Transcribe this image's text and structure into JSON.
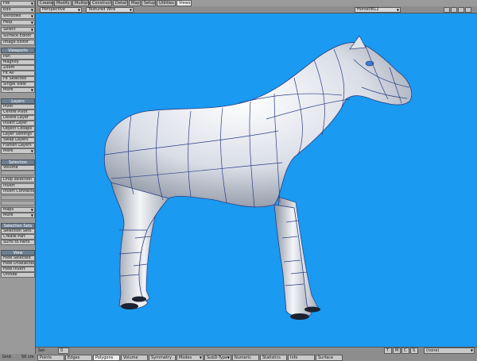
{
  "sidebar": {
    "top_menus": [
      "File",
      "Edit",
      "Windows",
      "Help"
    ],
    "select_label": "Select",
    "editor_buttons": [
      "Surface Editor",
      "Image Editor"
    ],
    "viewports_header": "Viewports",
    "viewports_items": [
      "Pan",
      "Magnify",
      "Zoom",
      "Fit All",
      "Fit Selected",
      "Single View",
      "More"
    ],
    "layers_header": "Layers",
    "layers_items": [
      "Pivot",
      "Centre Pivot",
      "Delete Layer",
      "Invert Layer",
      "Object Collaps",
      "Layer Settings",
      "Swap Layers",
      "Flatten Layers",
      "More"
    ],
    "selection_header": "Selection",
    "selection_items": [
      "Volume",
      "Drop selection",
      "Invert",
      "Invert Connected"
    ],
    "maps_label": "Maps",
    "more_label": "More",
    "selsets_header": "Selection Sets",
    "selsets_items": [
      "Selection Sets",
      "Create Part",
      "Surfs to Parts"
    ],
    "view_header": "View",
    "view_items": [
      "Hide Selected",
      "Hide Unselected",
      "Hide Invert",
      "Unhide"
    ]
  },
  "tabs": [
    "Create",
    "Modify",
    "Multiply",
    "Construct",
    "Detail",
    "Map",
    "Setup",
    "Utilities",
    "Views"
  ],
  "viewport_header": {
    "projection": "Perspective",
    "render_mode": "Textured Wire",
    "object_name": "Horse0B12"
  },
  "bottom_bar": {
    "sel_label": "Sel:",
    "sel_value": "0",
    "mode_buttons": [
      "T",
      "M",
      "C",
      "S"
    ],
    "vmap_value": "(none)"
  },
  "status_bar": {
    "grid_label": "Grid:",
    "grid_value": "50 cm",
    "items": [
      "Points",
      "Edges",
      "Polygons",
      "Volume",
      "Symmetry",
      "Modes",
      "SubD-Type",
      "Numeric",
      "Statistics",
      "Info",
      "Surface"
    ]
  },
  "colors": {
    "viewport_bg": "#1a9af0",
    "wire": "#2a3f86",
    "ui_grey": "#9a9a9a"
  }
}
